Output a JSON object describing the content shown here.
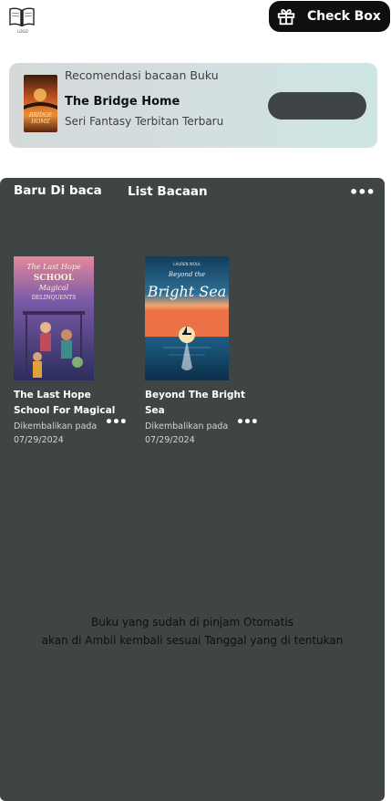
{
  "header": {
    "logo_caption": "LOGO",
    "checkbox_label": "Check Box"
  },
  "recommendation": {
    "heading": "Recomendasi bacaan Buku",
    "title": "The Bridge Home",
    "subtitle": "Seri Fantasy Terbitan Terbaru",
    "cover_text": "BRIDGE HOME"
  },
  "panel": {
    "tabs": [
      {
        "label": "Baru Di baca"
      },
      {
        "label": "List Bacaan"
      }
    ],
    "menu_icon": "more-horizontal-icon",
    "books": [
      {
        "title": "The Last Hope School For Magical",
        "meta_label": "Dikembalikan pada",
        "date": "07/29/2024",
        "cover_text": "The Last Hope School Magical Delinquents"
      },
      {
        "title": "Beyond The Bright Sea",
        "meta_label": "Dikembalikan pada",
        "date": "07/29/2024",
        "cover_author": "LAUREN WOLK",
        "cover_text": "Beyond the Bright Sea"
      }
    ],
    "notice_line1": "Buku yang sudah di pinjam Otomatis",
    "notice_line2": "akan di Ambil kembali sesuai Tanggal yang di tentukan"
  },
  "colors": {
    "panel_bg": "#3f4545",
    "card_gradient_start": "#d5d9da",
    "card_gradient_end": "#cde5e3",
    "button_dark": "#0f0f0f",
    "pill_button": "#3f4546"
  }
}
